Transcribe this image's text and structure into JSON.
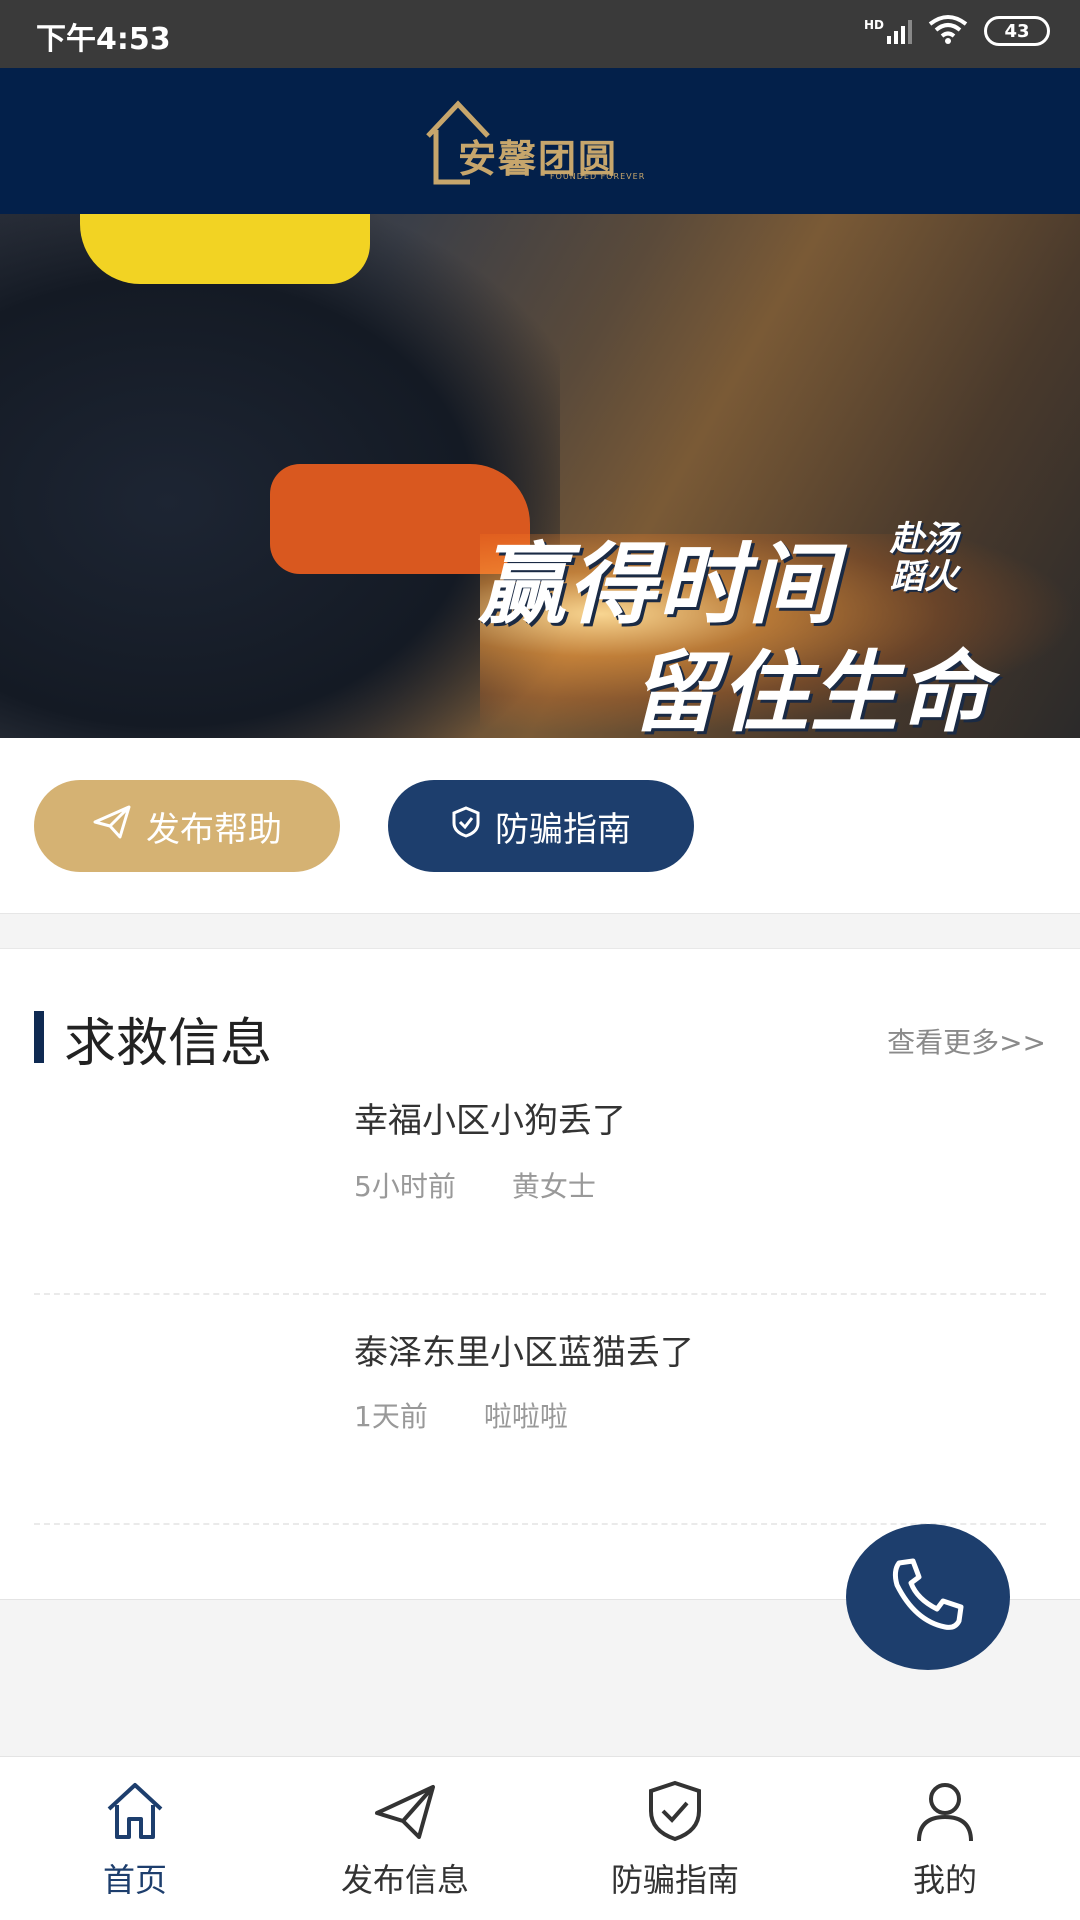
{
  "status_bar": {
    "time": "下午4:53",
    "battery": "43",
    "network": "HD"
  },
  "header": {
    "logo_text": "安馨团圆",
    "logo_sub": "FOUNDED FOREVER"
  },
  "banner": {
    "line1": "赢得时间",
    "line2": "留住生命",
    "side_text": "赴汤蹈火",
    "dots": 3
  },
  "actions": {
    "help_label": "发布帮助",
    "guide_label": "防骗指南"
  },
  "section": {
    "title": "求救信息",
    "more": "查看更多>>",
    "items": [
      {
        "title": "幸福小区小狗丢了",
        "time": "5小时前",
        "author": "黄女士"
      },
      {
        "title": "泰泽东里小区蓝猫丢了",
        "time": "1天前",
        "author": "啦啦啦"
      }
    ]
  },
  "tabbar": {
    "tabs": [
      {
        "label": "首页",
        "icon": "home-icon",
        "active": true
      },
      {
        "label": "发布信息",
        "icon": "send-icon",
        "active": false
      },
      {
        "label": "防骗指南",
        "icon": "shield-icon",
        "active": false
      },
      {
        "label": "我的",
        "icon": "user-icon",
        "active": false
      }
    ]
  },
  "colors": {
    "navy": "#03204a",
    "gold": "#d5b273",
    "blue": "#1d3e6d"
  }
}
